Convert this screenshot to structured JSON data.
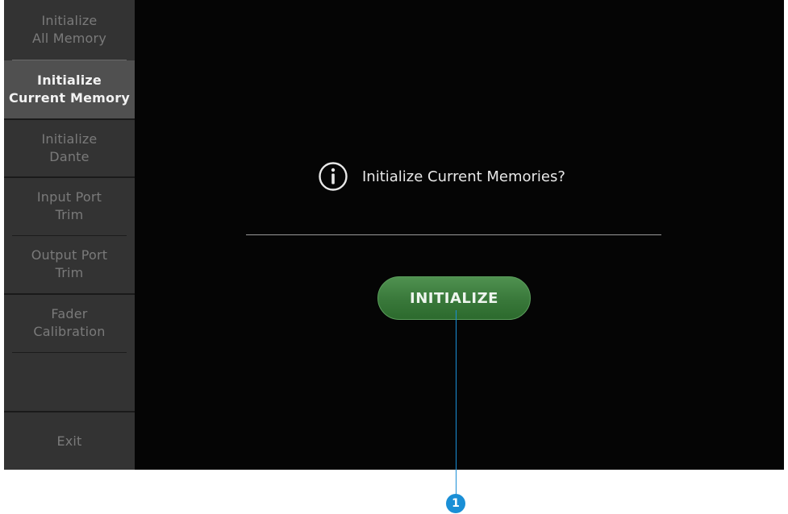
{
  "sidebar": {
    "items": [
      {
        "label": "Initialize\nAll Memory"
      },
      {
        "label": "Initialize\nCurrent Memory"
      },
      {
        "label": "Initialize\nDante"
      },
      {
        "label": "Input Port\nTrim"
      },
      {
        "label": "Output Port\nTrim"
      },
      {
        "label": "Fader\nCalibration"
      }
    ],
    "active_index": 1,
    "exit_label": "Exit"
  },
  "dialog": {
    "icon": "info-icon",
    "prompt": "Initialize Current Memories?",
    "button_label": "INITIALIZE"
  },
  "callout": {
    "number": "1"
  },
  "colors": {
    "screen_bg": "#050505",
    "sidebar_bg": "#333333",
    "sidebar_active_bg": "#505050",
    "button_green": "#39783a",
    "callout_blue": "#1a8fd6"
  }
}
